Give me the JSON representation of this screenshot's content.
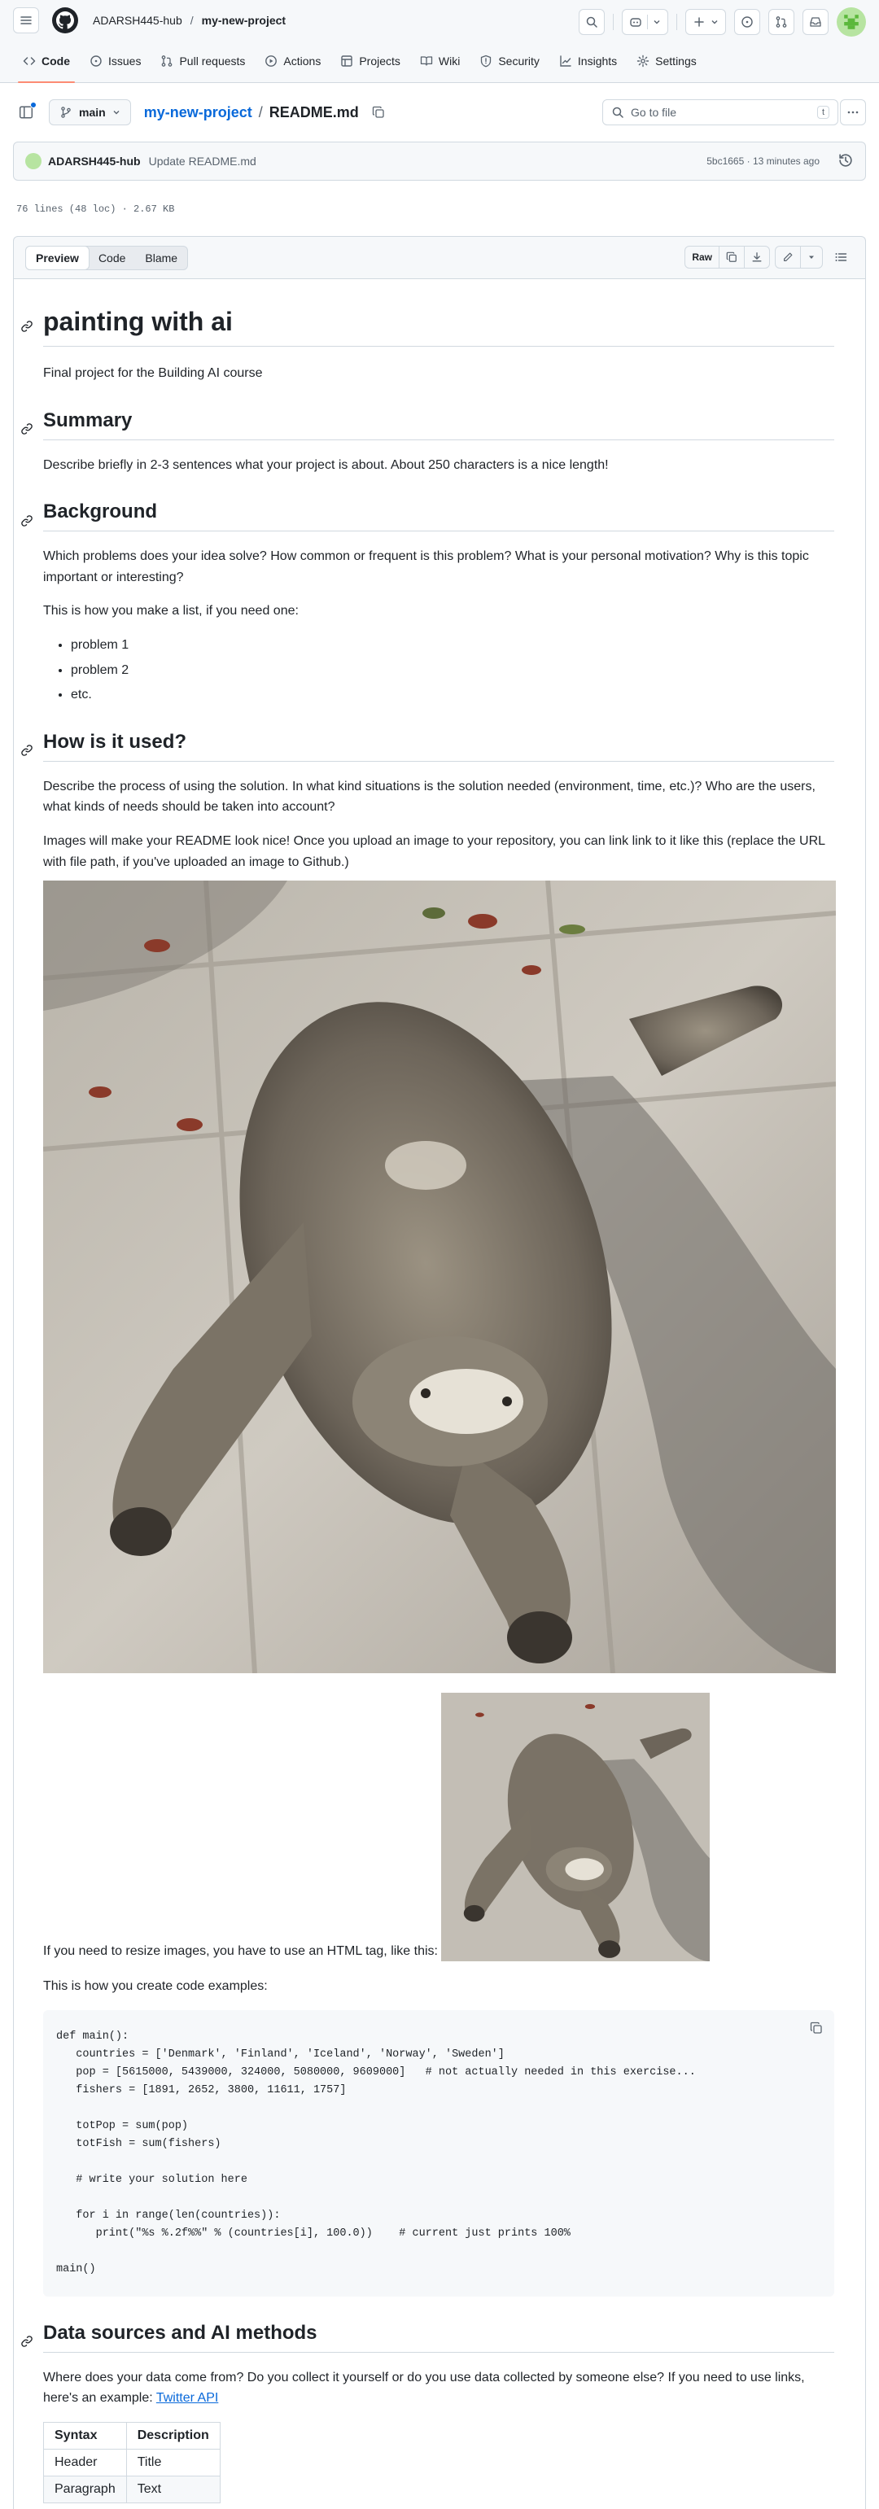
{
  "header": {
    "owner": "ADARSH445-hub",
    "separator": "/",
    "repo": "my-new-project"
  },
  "tabs": [
    {
      "label": "Code",
      "icon": "code-icon",
      "active": true
    },
    {
      "label": "Issues",
      "icon": "issue-icon"
    },
    {
      "label": "Pull requests",
      "icon": "pull-request-icon"
    },
    {
      "label": "Actions",
      "icon": "play-icon"
    },
    {
      "label": "Projects",
      "icon": "table-icon"
    },
    {
      "label": "Wiki",
      "icon": "book-icon"
    },
    {
      "label": "Security",
      "icon": "shield-icon"
    },
    {
      "label": "Insights",
      "icon": "graph-icon"
    },
    {
      "label": "Settings",
      "icon": "gear-icon"
    }
  ],
  "file_header": {
    "branch": "main",
    "repo_link": "my-new-project",
    "path_sep": "/",
    "file_name": "README.md",
    "goto_placeholder": "Go to file",
    "goto_shortcut": "t"
  },
  "commit": {
    "author": "ADARSH445-hub",
    "message": "Update README.md",
    "meta": "5bc1665 · 13 minutes ago"
  },
  "file_info": "76 lines (48 loc) · 2.67 KB",
  "viewer": {
    "modes": [
      "Preview",
      "Code",
      "Blame"
    ],
    "raw_label": "Raw"
  },
  "readme": {
    "title": "painting with ai",
    "intro": "Final project for the Building AI course",
    "summary_heading": "Summary",
    "summary_text": "Describe briefly in 2-3 sentences what your project is about. About 250 characters is a nice length!",
    "background_heading": "Background",
    "background_text": "Which problems does your idea solve? How common or frequent is this problem? What is your personal motivation? Why is this topic important or interesting?",
    "list_intro": "This is how you make a list, if you need one:",
    "list_items": [
      "problem 1",
      "problem 2",
      "etc."
    ],
    "usage_heading": "How is it used?",
    "usage_text": "Describe the process of using the solution. In what kind situations is the solution needed (environment, time, etc.)? Who are the users, what kinds of needs should be taken into account?",
    "images_text": "Images will make your README look nice! Once you upload an image to your repository, you can link link to it like this (replace the URL with file path, if you've uploaded an image to Github.)",
    "resize_text": "If you need to resize images, you have to use an HTML tag, like this:",
    "code_intro": "This is how you create code examples:",
    "code": "def main():\n   countries = ['Denmark', 'Finland', 'Iceland', 'Norway', 'Sweden']\n   pop = [5615000, 5439000, 324000, 5080000, 9609000]   # not actually needed in this exercise...\n   fishers = [1891, 2652, 3800, 11611, 1757]\n\n   totPop = sum(pop)\n   totFish = sum(fishers)\n\n   # write your solution here\n\n   for i in range(len(countries)):\n      print(\"%s %.2f%%\" % (countries[i], 100.0))    # current just prints 100%\n\nmain()",
    "data_heading": "Data sources and AI methods",
    "data_text": "Where does your data come from? Do you collect it yourself or do you use data collected by someone else? If you need to use links, here's an example:",
    "data_link": "Twitter API",
    "table": {
      "headers": [
        "Syntax",
        "Description"
      ],
      "rows": [
        [
          "Header",
          "Title"
        ],
        [
          "Paragraph",
          "Text"
        ]
      ]
    }
  }
}
